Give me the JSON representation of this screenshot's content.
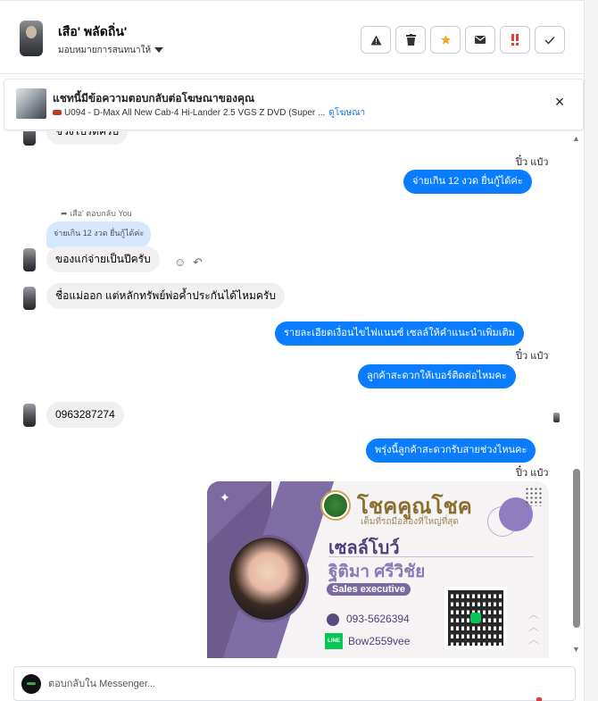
{
  "header": {
    "contact_name": "เสือ' พลัดถิ่น'",
    "assign_label": "มอบหมายการสนทนาให้",
    "actions": [
      {
        "name": "report-button",
        "glyph": "▲"
      },
      {
        "name": "delete-button",
        "glyph": "🗑"
      },
      {
        "name": "star-button",
        "glyph": "★"
      },
      {
        "name": "mail-button",
        "glyph": "✉"
      },
      {
        "name": "important-button",
        "glyph": "!!"
      },
      {
        "name": "done-button",
        "glyph": "✓"
      }
    ]
  },
  "ad_banner": {
    "title": "แชทนี้มีข้อความตอบกลับต่อโฆษณาของคุณ",
    "description": "U094 - D-Max All New Cab-4 Hi-Lander 2.5 VGS Z DVD (Super ...",
    "link": "ดูโฆษณา",
    "close": "×"
  },
  "messages": {
    "partial_top": "ช่วงโปรดครับ",
    "sender_1": "ปิ๋ว แป๋ว",
    "out_1": "จ่ายเกิน 12 งวด ยื่นกู้ได้ค่ะ",
    "reply_label": "เสือ' ตอบกลับ You",
    "quoted": "จ่ายเกิน 12 งวด ยื่นกู้ได้ค่ะ",
    "in_1": "ของแก่จ่ายเป็นปีครับ",
    "in_2": "ชื่อแม่ออก แต่หลักทรัพย์พ่อค้ำประกันได้ไหมครับ",
    "out_2": "รายละเอียดเงื่อนไขไฟแนนซ์ เซลล์ให้คำแนะนำเพิ่มเติม",
    "sender_2": "ปิ๋ว แป๋ว",
    "out_3": "ลูกค้าสะดวกให้เบอร์ติดต่อไหมคะ",
    "in_3": "0963287274",
    "out_4": "พรุ่งนี้ลูกค้าสะดวกรับสายช่วงไหนคะ",
    "sender_3": "ปิ๋ว แป๋ว"
  },
  "business_card": {
    "brand": "โชคคูณโชค",
    "tagline": "เต็มที่รถมือสองที่ใหญ่ที่สุด",
    "name_nick": "เซลล์โบว์",
    "name_full": "ฐิติมา ศรีวิชัย",
    "role": "Sales executive",
    "phone": "093-5626394",
    "line_badge": "LINE",
    "line_id": "Bow2559vee"
  },
  "composer": {
    "placeholder": "ตอบกลับใน Messenger..."
  },
  "colors": {
    "outgoing_bubble": "#0a7cff",
    "incoming_bubble": "#f0f0f0",
    "quoted_bubble": "#d6e8ff",
    "star": "#f5a623",
    "important": "#e53935",
    "link": "#1877f2"
  }
}
